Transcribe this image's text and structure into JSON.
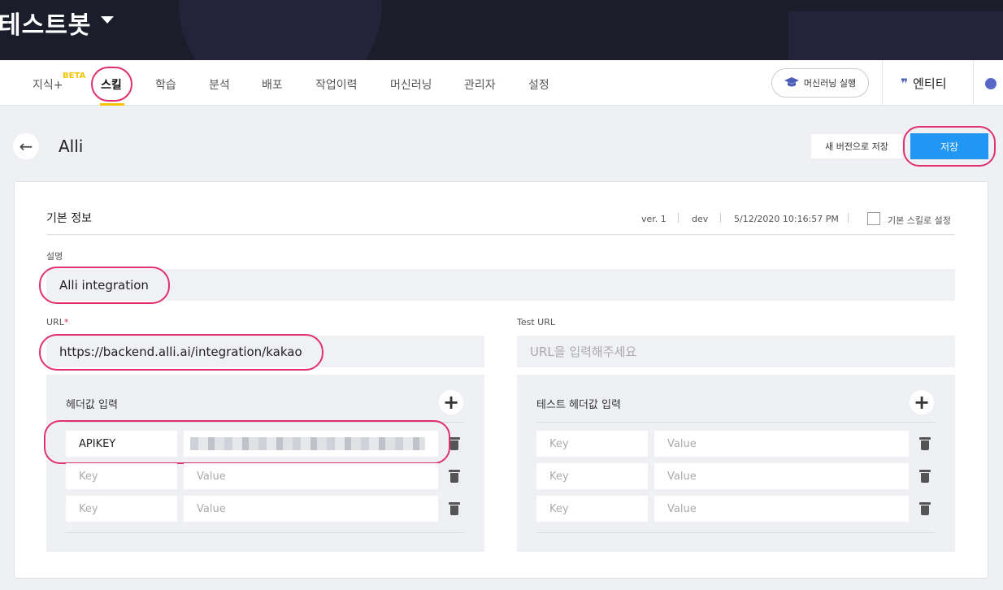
{
  "app": {
    "title": "테스트봇"
  },
  "nav": {
    "tabs": [
      {
        "label": "지식+",
        "badge": "BETA"
      },
      {
        "label": "스킬",
        "active": true
      },
      {
        "label": "학습"
      },
      {
        "label": "분석"
      },
      {
        "label": "배포"
      },
      {
        "label": "작업이력"
      },
      {
        "label": "머신러닝"
      },
      {
        "label": "관리자"
      },
      {
        "label": "설정"
      }
    ],
    "ml_button": "머신러닝 실행",
    "entity_label": "엔티티",
    "entity_icon": "quote-icon"
  },
  "header": {
    "title": "Alli",
    "new_version_button": "새 버전으로 저장",
    "save_button": "저장"
  },
  "basic_info": {
    "title": "기본 정보",
    "version": "ver. 1",
    "env": "dev",
    "timestamp": "5/12/2020 10:16:57 PM",
    "default_skill_label": "기본 스킬로 설정",
    "default_skill_checked": false
  },
  "description": {
    "label": "설명",
    "value": "Alli integration"
  },
  "url": {
    "label": "URL",
    "required_mark": "*",
    "value": "https://backend.alli.ai/integration/kakao"
  },
  "test_url": {
    "label": "Test URL",
    "placeholder": "URL을 입력해주세요"
  },
  "headers": {
    "title": "헤더값 입력",
    "rows": [
      {
        "key": "APIKEY",
        "value": "",
        "masked": true
      },
      {
        "key": "",
        "key_placeholder": "Key",
        "value_placeholder": "Value"
      },
      {
        "key": "",
        "key_placeholder": "Key",
        "value_placeholder": "Value"
      }
    ]
  },
  "test_headers": {
    "title": "테스트 헤더값 입력",
    "rows": [
      {
        "key_placeholder": "Key",
        "value_placeholder": "Value"
      },
      {
        "key_placeholder": "Key",
        "value_placeholder": "Value"
      },
      {
        "key_placeholder": "Key",
        "value_placeholder": "Value"
      }
    ]
  },
  "colors": {
    "accent": "#f5c400",
    "primary": "#2196f3",
    "highlight": "#e0306e",
    "topbar": "#1c1d2b"
  }
}
